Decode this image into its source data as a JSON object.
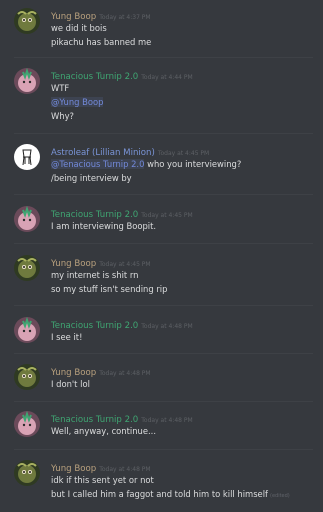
{
  "colors": {
    "background": "#36393e",
    "text": "#dcddde",
    "timestamp": "#5d6065",
    "mention": "#7289da",
    "yung_boop": "#b9a17e",
    "tenacious_turnip": "#3fa572",
    "astroleaf": "#7a95d8"
  },
  "messages": [
    {
      "author": "Yung Boop",
      "timestamp": "Today at 4:37 PM",
      "lines": [
        "we did it bois",
        "pikachu has banned me"
      ]
    },
    {
      "author": "Tenacious Turnip 2.0",
      "timestamp": "Today at 4:44 PM",
      "lines": [
        "WTF",
        "@Yung Boop",
        "Why?"
      ]
    },
    {
      "author": "Astroleaf (Lillian Minion)",
      "timestamp": "Today at 4:45 PM",
      "lines": [
        "@Tenacious Turnip 2.0",
        "who you interviewing?",
        "/being interview by"
      ]
    },
    {
      "author": "Tenacious Turnip 2.0",
      "timestamp": "Today at 4:45 PM",
      "lines": [
        "I am interviewing Boopit."
      ]
    },
    {
      "author": "Yung Boop",
      "timestamp": "Today at 4:45 PM",
      "lines": [
        "my internet is shit rn",
        "so my stuff isn't sending rip"
      ]
    },
    {
      "author": "Tenacious Turnip 2.0",
      "timestamp": "Today at 4:48 PM",
      "lines": [
        "I see it!"
      ]
    },
    {
      "author": "Yung Boop",
      "timestamp": "Today at 4:48 PM",
      "lines": [
        "I don't lol"
      ]
    },
    {
      "author": "Tenacious Turnip 2.0",
      "timestamp": "Today at 4:48 PM",
      "lines": [
        "Well, anyway, continue..."
      ]
    },
    {
      "author": "Yung Boop",
      "timestamp": "Today at 4:48 PM",
      "lines": [
        "idk if this sent yet or not",
        "but I called him a faggot and told him to kill himself"
      ],
      "edited": "(edited)"
    }
  ]
}
